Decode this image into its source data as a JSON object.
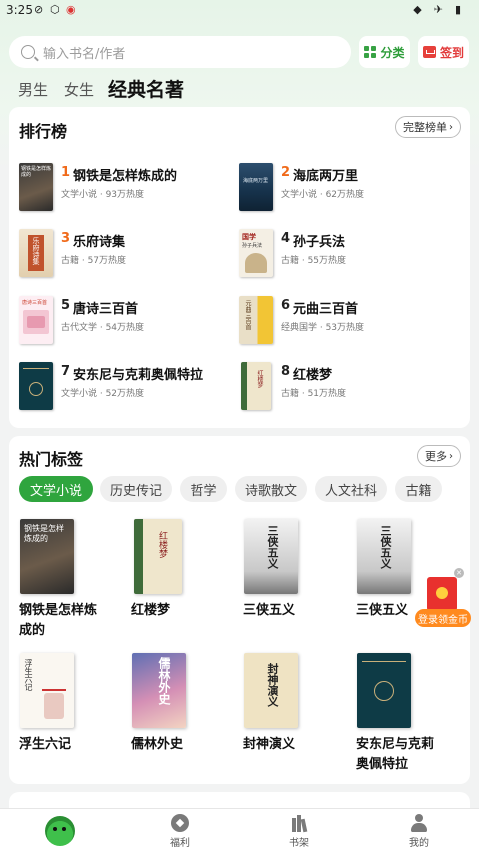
{
  "status_bar": {
    "time": "3:25"
  },
  "search": {
    "placeholder": "输入书名/作者"
  },
  "header_buttons": {
    "category": "分类",
    "signin": "签到"
  },
  "gender_tabs": [
    "男生",
    "女生",
    "经典名著"
  ],
  "ranking": {
    "title": "排行榜",
    "more": "完整榜单",
    "items": [
      {
        "rank": "1",
        "title": "钢铁是怎样炼成的",
        "meta": "文学小说 · 93万热度"
      },
      {
        "rank": "2",
        "title": "海底两万里",
        "meta": "文学小说 · 62万热度"
      },
      {
        "rank": "3",
        "title": "乐府诗集",
        "meta": "古籍 · 57万热度"
      },
      {
        "rank": "4",
        "title": "孙子兵法",
        "meta": "古籍 · 55万热度"
      },
      {
        "rank": "5",
        "title": "唐诗三百首",
        "meta": "古代文学 · 54万热度"
      },
      {
        "rank": "6",
        "title": "元曲三百首",
        "meta": "经典国学 · 53万热度"
      },
      {
        "rank": "7",
        "title": "安东尼与克莉奥佩特拉",
        "meta": "文学小说 · 52万热度"
      },
      {
        "rank": "8",
        "title": "红楼梦",
        "meta": "古籍 · 51万热度"
      }
    ],
    "covers": {
      "c1": "钢铁是怎样炼成的",
      "c2": "海底两万里",
      "c3": "乐府诗集",
      "c4": "国学",
      "c4b": "孙子兵法",
      "c5": "唐诗三百首",
      "c6": "元曲三百首",
      "c8": "红楼梦"
    }
  },
  "hot_tags": {
    "title": "热门标签",
    "more": "更多",
    "tags": [
      "文学小说",
      "历史传记",
      "哲学",
      "诗歌散文",
      "人文社科",
      "古籍"
    ],
    "books": [
      {
        "title": "钢铁是怎样炼成的",
        "cover": "钢铁是怎样炼成的"
      },
      {
        "title": "红楼梦",
        "cover": "红楼梦"
      },
      {
        "title": "三侠五义",
        "cover": "三侠五义"
      },
      {
        "title": "三侠五义",
        "cover": "三侠五义"
      },
      {
        "title": "浮生六记",
        "cover": "浮生六记"
      },
      {
        "title": "儒林外史",
        "cover": "儒林外史"
      },
      {
        "title": "封神演义",
        "cover": "封神演义"
      },
      {
        "title": "安东尼与克莉奥佩特拉",
        "cover": ""
      }
    ]
  },
  "float_badge": {
    "label": "登录领金币"
  },
  "bottom_nav": {
    "welfare": "福利",
    "bookshelf": "书架",
    "mine": "我的"
  },
  "colors": {
    "accent_green": "#2fa53e",
    "rank_orange": "#f06a1a",
    "signin_red": "#e23a3a"
  }
}
